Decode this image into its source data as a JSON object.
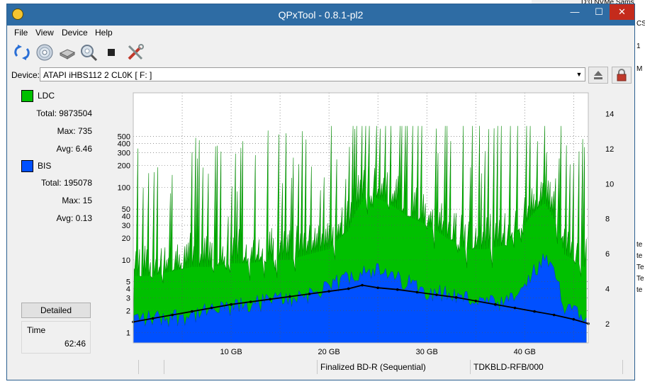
{
  "background": {
    "top_text": "D:0 NVMe   Sams",
    "right_fragments": [
      "CS",
      "1",
      "M",
      "te",
      "te",
      "Te",
      "Te",
      "te"
    ]
  },
  "window": {
    "title": "QPxTool - 0.8.1-pl2",
    "controls": {
      "minimize": "—",
      "maximize": "☐",
      "close": "✕"
    }
  },
  "menu": [
    "File",
    "View",
    "Device",
    "Help"
  ],
  "toolbar": {
    "buttons": [
      "refresh-icon",
      "disc-info-icon",
      "drive-icon",
      "scan-icon",
      "stop-icon",
      "tools-icon"
    ]
  },
  "device": {
    "label": "Device:",
    "value": "ATAPI   iHBS112   2     CL0K [ F: ]"
  },
  "stats": {
    "ldc": {
      "label": "LDC",
      "color": "#00c000",
      "total": "Total: 9873504",
      "max": "Max: 735",
      "avg": "Avg: 6.46"
    },
    "bis": {
      "label": "BIS",
      "color": "#0050ff",
      "total": "Total: 195078",
      "max": "Max: 15",
      "avg": "Avg: 0.13"
    },
    "detailed_button": "Detailed",
    "time_label": "Time",
    "time_value": "62:46"
  },
  "chart_data": {
    "type": "bar",
    "x_unit": "GB",
    "xlim": [
      0,
      46.5
    ],
    "x_ticks": [
      10,
      20,
      30,
      40
    ],
    "x_tick_labels": [
      "10 GB",
      "20 GB",
      "30 GB",
      "40 GB"
    ],
    "y_left_scale": "log",
    "y_left_ticks": [
      1,
      2,
      3,
      4,
      5,
      10,
      20,
      30,
      40,
      50,
      100,
      200,
      300,
      400,
      500
    ],
    "y_right_ticks": [
      2,
      4,
      6,
      8,
      10,
      12,
      14
    ],
    "grid": true,
    "series": [
      {
        "name": "LDC",
        "color": "#00c000",
        "x": [
          2,
          4,
          6,
          8,
          10,
          12,
          14,
          16,
          18,
          20,
          22,
          24,
          26,
          28,
          30,
          32,
          34,
          36,
          38,
          40,
          42,
          44,
          46
        ],
        "values": [
          6,
          7,
          8,
          8,
          9,
          9,
          10,
          10,
          12,
          14,
          25,
          80,
          60,
          40,
          30,
          20,
          14,
          14,
          16,
          30,
          60,
          12,
          8
        ]
      },
      {
        "name": "BIS",
        "color": "#0050ff",
        "x": [
          2,
          4,
          6,
          8,
          10,
          12,
          14,
          16,
          18,
          20,
          22,
          24,
          26,
          28,
          30,
          32,
          34,
          36,
          38,
          40,
          42,
          44,
          46
        ],
        "values": [
          1.6,
          1.7,
          1.8,
          2,
          2.2,
          2.5,
          2.8,
          3,
          3.5,
          4,
          6,
          8,
          6,
          5,
          4,
          3.5,
          3,
          2.6,
          2.4,
          4,
          10,
          2.5,
          2
        ]
      },
      {
        "name": "Speed",
        "color": "#000000",
        "x": [
          0,
          2,
          4,
          6,
          8,
          10,
          12,
          14,
          16,
          18,
          20,
          22,
          23.4,
          25,
          27,
          29,
          31,
          33,
          35,
          37,
          39,
          41,
          43,
          45,
          46.5
        ],
        "values": [
          2.1,
          2.3,
          2.5,
          2.7,
          2.9,
          3.1,
          3.25,
          3.4,
          3.55,
          3.7,
          3.85,
          4.0,
          4.2,
          4.05,
          3.95,
          3.8,
          3.65,
          3.5,
          3.3,
          3.1,
          2.9,
          2.7,
          2.5,
          2.25,
          2.0
        ]
      }
    ]
  },
  "status": {
    "cells": [
      "",
      "",
      "",
      "Finalized BD-R (Sequential)",
      "TDKBLD-RFB/000",
      ""
    ]
  }
}
